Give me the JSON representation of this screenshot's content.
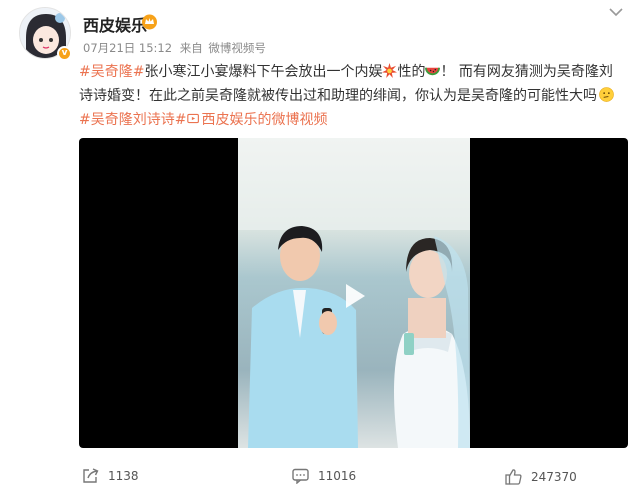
{
  "post": {
    "author_name": "西皮娱乐",
    "meta": {
      "time": "07月21日 15:12",
      "source_prefix": "来自",
      "source": "微博视频号"
    },
    "text": {
      "line1_topic": "#吴奇隆#",
      "line1_text_a": "张小寒江小宴爆料下午会放出一个内娱",
      "line1_text_b": "性的",
      "line1_text_c": "！ 而有网友猜测为吴奇隆刘",
      "line2_text": "诗诗婚变！在此之前吴奇隆就被传出过和助理的绯闻，你认为是吴奇隆的可能性大吗",
      "line3_topic": "#吴奇隆刘诗诗#",
      "line3_link": "西皮娱乐的微博视频"
    },
    "icons": {
      "verified": "verified-badge-icon",
      "crown": "crown-icon",
      "more": "chevron-down-icon",
      "explosion": "explosion-emoji-icon",
      "melon": "watermelon-emoji-icon",
      "thinking": "thinking-emoji-icon",
      "video_link": "video-link-icon",
      "play": "play-icon",
      "share": "share-icon",
      "comment": "comment-icon",
      "like": "like-icon"
    },
    "actions": {
      "share_count": "1138",
      "comment_count": "11016",
      "like_count": "247370"
    },
    "colors": {
      "topic": "#eb7350",
      "badge": "#f7a21a"
    }
  }
}
